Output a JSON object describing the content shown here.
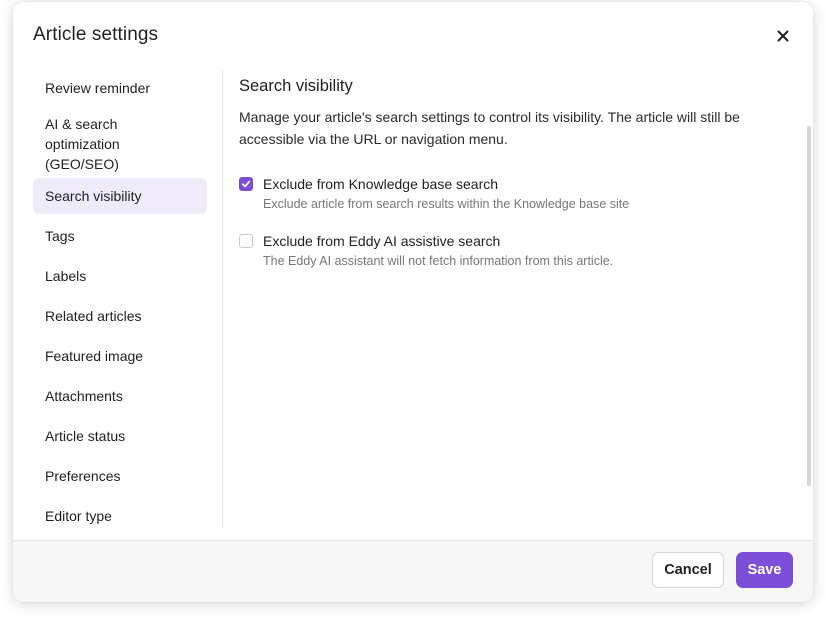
{
  "dialog": {
    "title": "Article settings"
  },
  "sidebar": {
    "items": [
      {
        "label": "Review reminder",
        "active": false
      },
      {
        "label": "AI & search optimization (GEO/SEO)",
        "active": false
      },
      {
        "label": "Search visibility",
        "active": true
      },
      {
        "label": "Tags",
        "active": false
      },
      {
        "label": "Labels",
        "active": false
      },
      {
        "label": "Related articles",
        "active": false
      },
      {
        "label": "Featured image",
        "active": false
      },
      {
        "label": "Attachments",
        "active": false
      },
      {
        "label": "Article status",
        "active": false
      },
      {
        "label": "Preferences",
        "active": false
      },
      {
        "label": "Editor type",
        "active": false
      }
    ]
  },
  "main": {
    "title": "Search visibility",
    "description": "Manage your article's search settings to control its visibility. The article will still be accessible via the URL or navigation menu.",
    "options": [
      {
        "label": "Exclude from Knowledge base search",
        "help": "Exclude article from search results within the Knowledge base site",
        "checked": true
      },
      {
        "label": "Exclude from Eddy AI assistive search",
        "help": "The Eddy AI assistant will not fetch information from this article.",
        "checked": false
      }
    ]
  },
  "footer": {
    "cancel_label": "Cancel",
    "save_label": "Save"
  },
  "colors": {
    "accent": "#7b4fd8",
    "active_nav_bg": "#efebfb"
  },
  "icons": {
    "close": "close-icon",
    "check": "check-icon"
  }
}
